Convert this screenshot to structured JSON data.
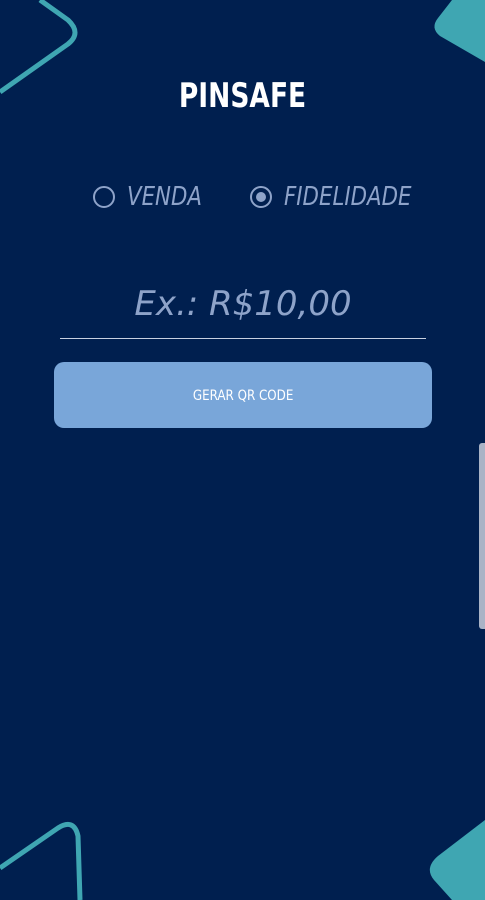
{
  "app": {
    "title": "PINSAFE"
  },
  "mode_selector": {
    "options": [
      {
        "label": "VENDA",
        "selected": false
      },
      {
        "label": "FIDELIDADE",
        "selected": true
      }
    ]
  },
  "amount": {
    "value": "",
    "placeholder": "Ex.: R$10,00"
  },
  "actions": {
    "generate_label": "GERAR QR CODE"
  },
  "colors": {
    "background": "#001f4f",
    "accent_teal": "#3fa6b2",
    "button": "#79a6d9",
    "radio_text": "#8ea3c9"
  }
}
